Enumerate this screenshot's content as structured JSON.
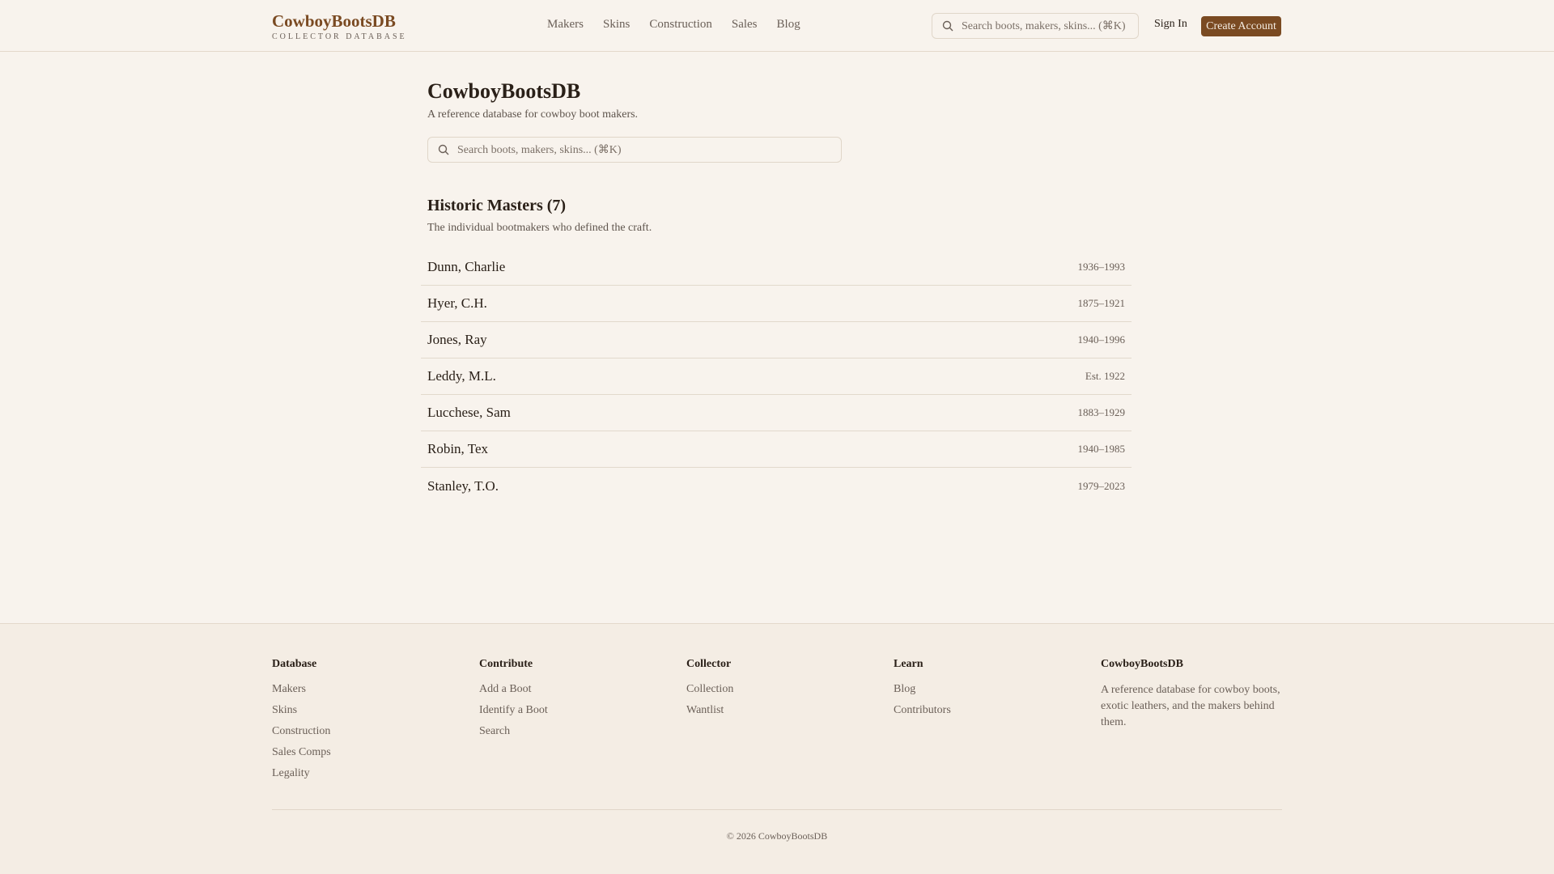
{
  "header": {
    "logo": "CowboyBootsDB",
    "tagline": "COLLECTOR DATABASE",
    "nav": [
      "Makers",
      "Skins",
      "Construction",
      "Sales",
      "Blog"
    ],
    "search_placeholder": "Search boots, makers, skins... (⌘K)",
    "sign_in": "Sign In",
    "create_account": "Create Account"
  },
  "main": {
    "title": "CowboyBootsDB",
    "subtitle": "A reference database for cowboy boot makers.",
    "search_placeholder": "Search boots, makers, skins... (⌘K)",
    "section": {
      "heading": "Historic Masters (7)",
      "description": "The individual bootmakers who defined the craft.",
      "makers": [
        {
          "name": "Dunn, Charlie",
          "dates": "1936–1993"
        },
        {
          "name": "Hyer, C.H.",
          "dates": "1875–1921"
        },
        {
          "name": "Jones, Ray",
          "dates": "1940–1996"
        },
        {
          "name": "Leddy, M.L.",
          "dates": "Est. 1922"
        },
        {
          "name": "Lucchese, Sam",
          "dates": "1883–1929"
        },
        {
          "name": "Robin, Tex",
          "dates": "1940–1985"
        },
        {
          "name": "Stanley, T.O.",
          "dates": "1979–2023"
        }
      ]
    }
  },
  "footer": {
    "columns": [
      {
        "title": "Database",
        "links": [
          "Makers",
          "Skins",
          "Construction",
          "Sales Comps",
          "Legality"
        ]
      },
      {
        "title": "Contribute",
        "links": [
          "Add a Boot",
          "Identify a Boot",
          "Search"
        ]
      },
      {
        "title": "Collector",
        "links": [
          "Collection",
          "Wantlist"
        ]
      },
      {
        "title": "Learn",
        "links": [
          "Blog",
          "Contributors"
        ]
      }
    ],
    "about": {
      "title": "CowboyBootsDB",
      "text": "A reference database for cowboy boots, exotic leathers, and the makers behind them."
    },
    "copyright": "© 2026 CowboyBootsDB"
  },
  "colors": {
    "background": "#f8f3ed",
    "accent": "#7a4a22"
  }
}
